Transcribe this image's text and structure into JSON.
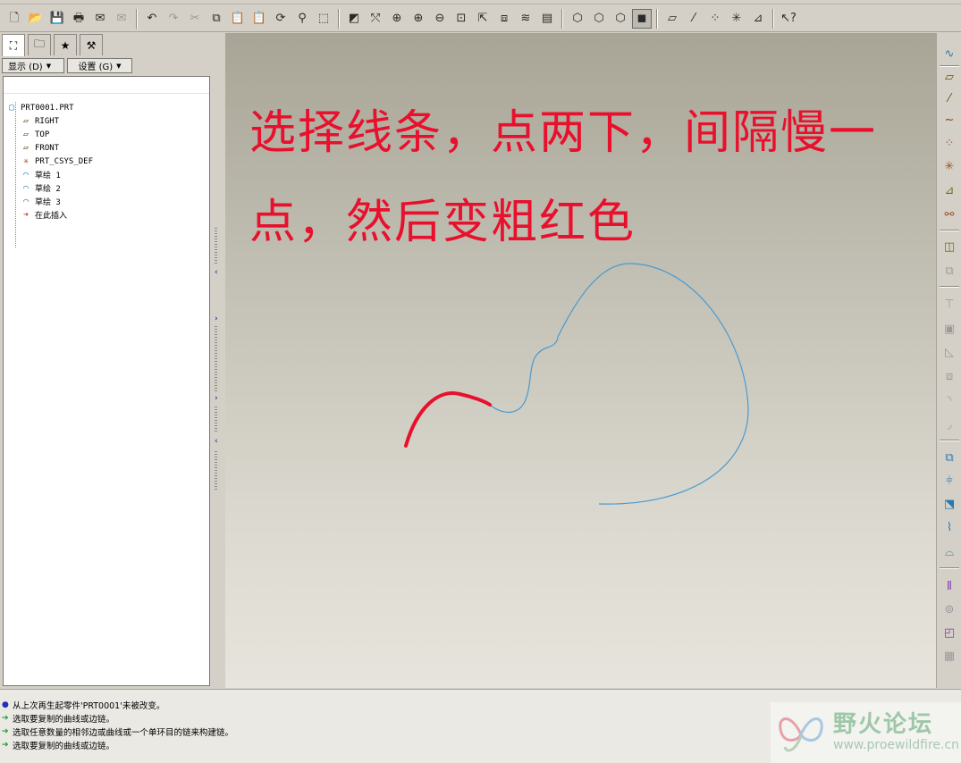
{
  "toolbar": {
    "icons": [
      "new-icon",
      "open-icon",
      "save-icon",
      "print-icon",
      "send-icon",
      "email-icon",
      "undo-icon",
      "redo-icon",
      "cut-icon",
      "copy-icon",
      "paste-icon",
      "paste-special-icon",
      "regenerate-icon",
      "find-icon",
      "select-box-icon",
      "sketch-display-icon",
      "spin-center-icon",
      "zoom-fit-icon",
      "zoom-in-icon",
      "zoom-out-icon",
      "refit-icon",
      "reorient-icon",
      "saved-view-icon",
      "layers-icon",
      "view-manager-icon",
      "wireframe-icon",
      "hidden-line-icon",
      "no-hidden-icon",
      "shading-icon",
      "datum-plane-display-icon",
      "datum-axis-display-icon",
      "datum-point-display-icon",
      "csys-display-icon",
      "annotation-display-icon",
      "context-help-icon"
    ]
  },
  "left_panel": {
    "tabs": [
      "model-tree-tab",
      "folder-browser-tab",
      "favorites-tab",
      "connections-tab"
    ],
    "show_button": "显示 (D)",
    "settings_button": "设置 (G)",
    "tree": {
      "root": "PRT0001.PRT",
      "items": [
        {
          "label": "RIGHT",
          "icon": "datum-plane-icon"
        },
        {
          "label": "TOP",
          "icon": "datum-plane-icon"
        },
        {
          "label": "FRONT",
          "icon": "datum-plane-icon"
        },
        {
          "label": "PRT_CSYS_DEF",
          "icon": "csys-icon"
        },
        {
          "label": "草绘 1",
          "icon": "sketch-icon"
        },
        {
          "label": "草绘 2",
          "icon": "sketch-icon"
        },
        {
          "label": "草绘 3",
          "icon": "sketch-icon"
        },
        {
          "label": "在此插入",
          "icon": "insert-here-icon"
        }
      ]
    }
  },
  "canvas": {
    "annotation_line1": "选择线条，点两下，间隔慢一",
    "annotation_line2": "点，然后变粗红色",
    "highlight_color": "#e8102c",
    "curve_color": "#4a9ad0"
  },
  "right_toolbar": {
    "icons": [
      "sketch-tool-icon",
      "datum-plane-tool-icon",
      "datum-axis-tool-icon",
      "datum-curve-tool-icon",
      "datum-point-tool-icon",
      "csys-tool-icon",
      "analysis-tool-icon",
      "insert-feature-icon",
      "style-tool-icon",
      "boundary-blend-icon",
      "extrude-icon",
      "shell-icon",
      "draft-icon",
      "rib-icon",
      "round-icon",
      "chamfer-icon",
      "copy-tool-icon",
      "mirror-icon",
      "merge-icon",
      "trim-icon",
      "thicken-icon",
      "pattern-icon",
      "offset-icon",
      "project-icon",
      "wrap-icon"
    ]
  },
  "messages": [
    {
      "type": "info",
      "text": "从上次再生起零件'PRT0001'未被改变。"
    },
    {
      "type": "prompt",
      "text": "选取要复制的曲线或边链。"
    },
    {
      "type": "prompt",
      "text": "选取任意数量的相邻边或曲线或一个单环目的链来构建链。"
    },
    {
      "type": "prompt",
      "text": "选取要复制的曲线或边链。"
    }
  ],
  "watermark": {
    "title": "野火论坛",
    "url": "www.proewildfire.cn"
  }
}
